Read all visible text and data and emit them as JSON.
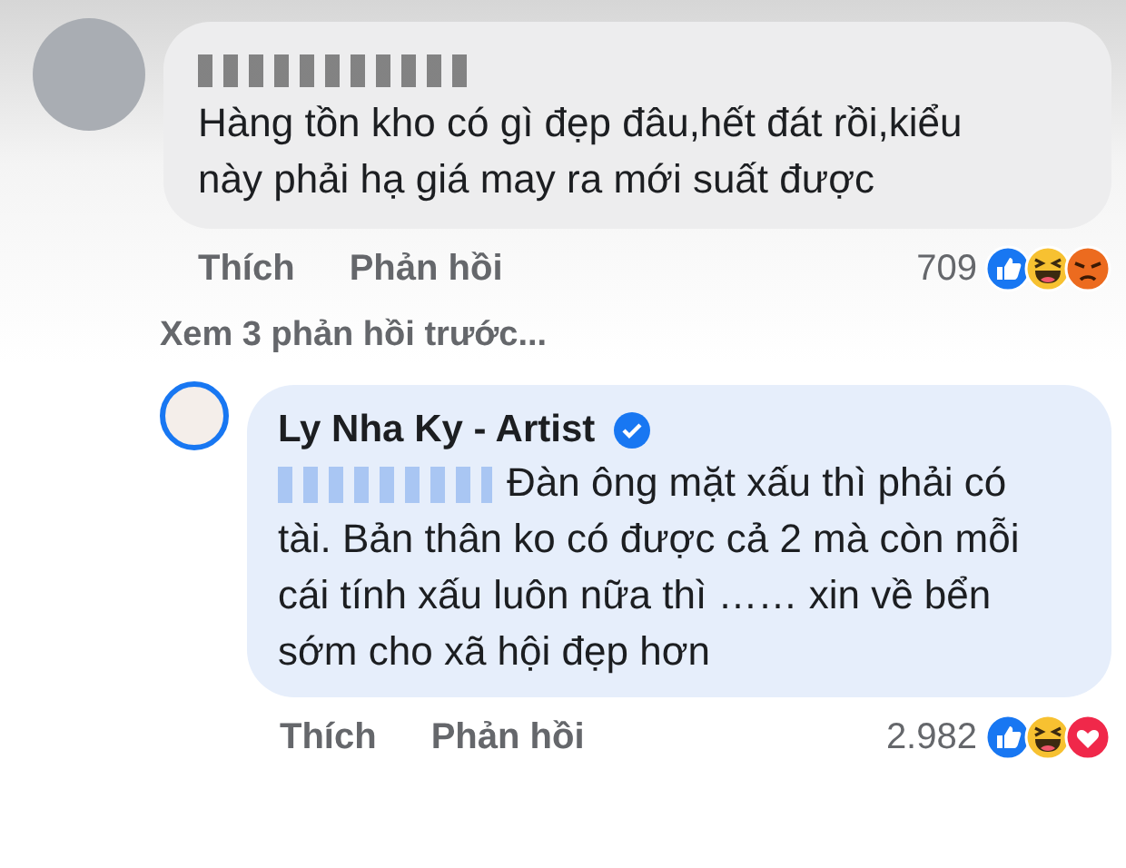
{
  "comments": [
    {
      "kind": "comment",
      "author": {
        "blurred": true,
        "verified": false
      },
      "mention": false,
      "text": "Hàng tồn kho có gì đẹp đâu,hết đát rồi,kiểu này phải hạ giá may ra mới suất được",
      "actions": [
        "Thích",
        "Phản hồi"
      ],
      "reaction_count": "709",
      "reactions": [
        {
          "kind": "like"
        },
        {
          "kind": "haha"
        },
        {
          "kind": "angry"
        }
      ]
    },
    {
      "kind": "more",
      "text": "Xem 3 phản hồi trước..."
    },
    {
      "kind": "reply",
      "author": {
        "blurred": false,
        "name": "Ly Nha Ky - Artist",
        "verified": true
      },
      "mention": true,
      "text": "Đàn ông mặt xấu thì phải có tài. Bản thân ko có được cả 2 mà còn mỗi cái tính xấu luôn nữa thì …… xin về bển sớm cho xã hội đẹp hơn",
      "actions": [
        "Thích",
        "Phản hồi"
      ],
      "reaction_count": "2.982",
      "reactions": [
        {
          "kind": "like"
        },
        {
          "kind": "haha"
        },
        {
          "kind": "love"
        }
      ]
    }
  ]
}
